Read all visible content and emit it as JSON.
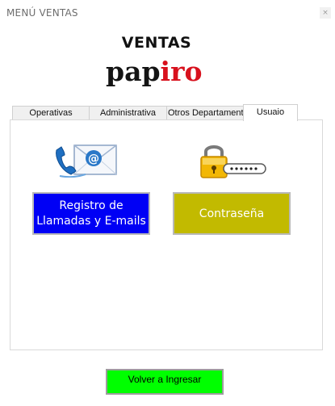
{
  "window": {
    "title": "MENÚ VENTAS",
    "close_glyph": "×"
  },
  "header": {
    "title": "VENTAS",
    "logo_part1": "pap",
    "logo_part2": "iro",
    "logo_colors": {
      "dark": "#141414",
      "red": "#d8111d"
    }
  },
  "tabs": [
    {
      "label": "Operativas",
      "active": false
    },
    {
      "label": "Administrativa",
      "active": false
    },
    {
      "label": "Otros Departamentos",
      "active": false
    },
    {
      "label": "Usuaio",
      "active": true
    }
  ],
  "panel": {
    "register_button": {
      "line1": "Registro de",
      "line2": "Llamadas y E-mails",
      "color": "#0000f5",
      "icon": "phone-email-icon"
    },
    "password_button": {
      "label": "Contraseña",
      "color": "#c2ba00",
      "icon": "padlock-password-icon"
    }
  },
  "footer": {
    "back_button": "Volver a Ingresar",
    "color": "#00ff00"
  }
}
